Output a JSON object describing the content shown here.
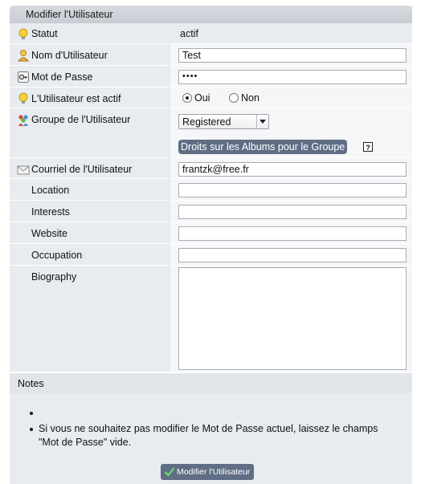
{
  "form": {
    "title": "Modifier l'Utilisateur"
  },
  "fields": {
    "status": {
      "label": "Statut",
      "value": "actif"
    },
    "username": {
      "label": "Nom d'Utilisateur",
      "value": "Test"
    },
    "password": {
      "label": "Mot de Passe",
      "value": "••••"
    },
    "active": {
      "label": "L'Utilisateur est actif",
      "options": [
        "Oui",
        "Non"
      ],
      "selected": "Oui"
    },
    "group": {
      "label": "Groupe de l'Utilisateur",
      "selected": "Registered",
      "rights_button": "Droits sur les Albums pour le Groupe",
      "help": "?"
    },
    "email": {
      "label": "Courriel de l'Utilisateur",
      "value": "frantzk@free.fr"
    },
    "location": {
      "label": "Location",
      "value": ""
    },
    "interests": {
      "label": "Interests",
      "value": ""
    },
    "website": {
      "label": "Website",
      "value": ""
    },
    "occupation": {
      "label": "Occupation",
      "value": ""
    },
    "biography": {
      "label": "Biography",
      "value": ""
    }
  },
  "notes": {
    "title": "Notes",
    "items": [
      "",
      "Si vous ne souhaitez pas modifier le Mot de Passe actuel, laissez le champs \"Mot de Passe\" vide."
    ]
  },
  "submit": {
    "label": "Modifier l'Utilisateur"
  },
  "icons": {
    "status": "lightbulb-icon",
    "username": "user-icon",
    "password": "key-icon",
    "active": "lightbulb-icon",
    "group": "group-icon",
    "email": "envelope-icon",
    "submit": "checkmark-icon"
  }
}
